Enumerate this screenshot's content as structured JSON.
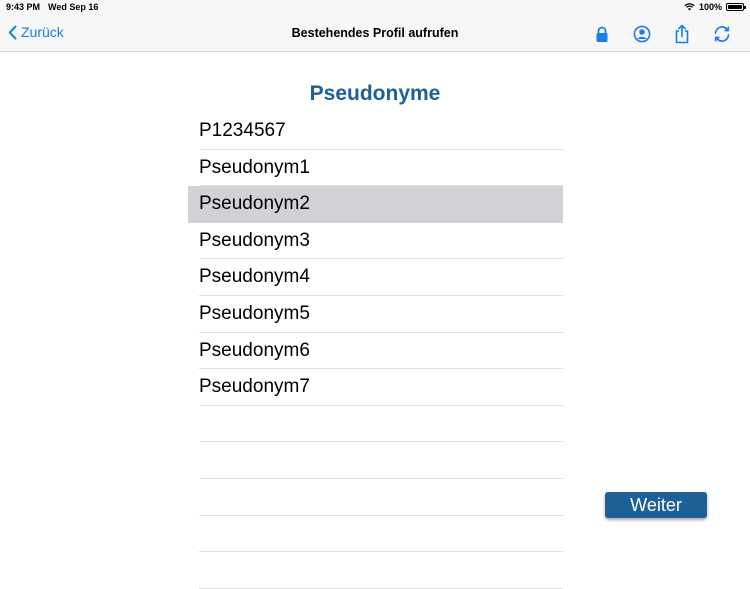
{
  "statusbar": {
    "time": "9:43 PM",
    "date": "Wed Sep 16",
    "battery": "100%"
  },
  "navbar": {
    "back_label": "Zurück",
    "title": "Bestehendes Profil aufrufen",
    "icons": [
      "lock-icon",
      "profile-icon",
      "share-icon",
      "refresh-icon"
    ]
  },
  "list": {
    "title": "Pseudonyme",
    "items": [
      "P1234567",
      "Pseudonym1",
      "Pseudonym2",
      "Pseudonym3",
      "Pseudonym4",
      "Pseudonym5",
      "Pseudonym6",
      "Pseudonym7",
      "",
      "",
      "",
      "",
      ""
    ],
    "selected_index": 2
  },
  "next_button": "Weiter",
  "colors": {
    "accent": "#1a7ee8",
    "brand": "#1d5f97",
    "selection": "#d1d1d6"
  }
}
